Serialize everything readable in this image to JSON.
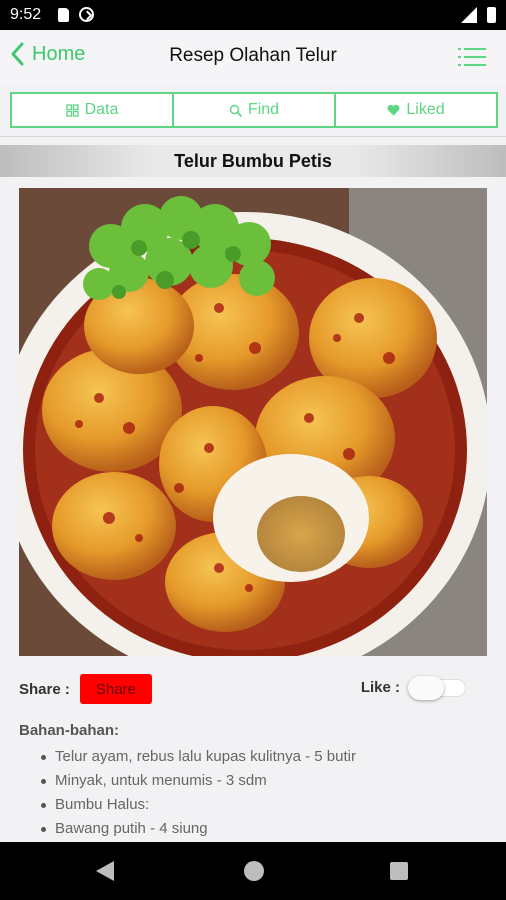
{
  "status_bar": {
    "time": "9:52"
  },
  "app_bar": {
    "back_label": "Home",
    "title": "Resep Olahan Telur"
  },
  "tabs": [
    {
      "label": "Data",
      "icon": "grid-icon"
    },
    {
      "label": "Find",
      "icon": "search-icon"
    },
    {
      "label": "Liked",
      "icon": "heart-icon"
    }
  ],
  "recipe": {
    "title": "Telur Bumbu Petis",
    "share_label": "Share :",
    "share_button": "Share",
    "like_label": "Like :",
    "like_enabled": false,
    "ingredients_heading": "Bahan-bahan:",
    "ingredients": [
      "Telur ayam, rebus lalu kupas kulitnya - 5 butir",
      "Minyak, untuk menumis - 3 sdm",
      "Bumbu Halus:",
      "Bawang putih - 4 siung"
    ]
  },
  "colors": {
    "accent": "#3ec96d",
    "share": "#ff0000"
  }
}
